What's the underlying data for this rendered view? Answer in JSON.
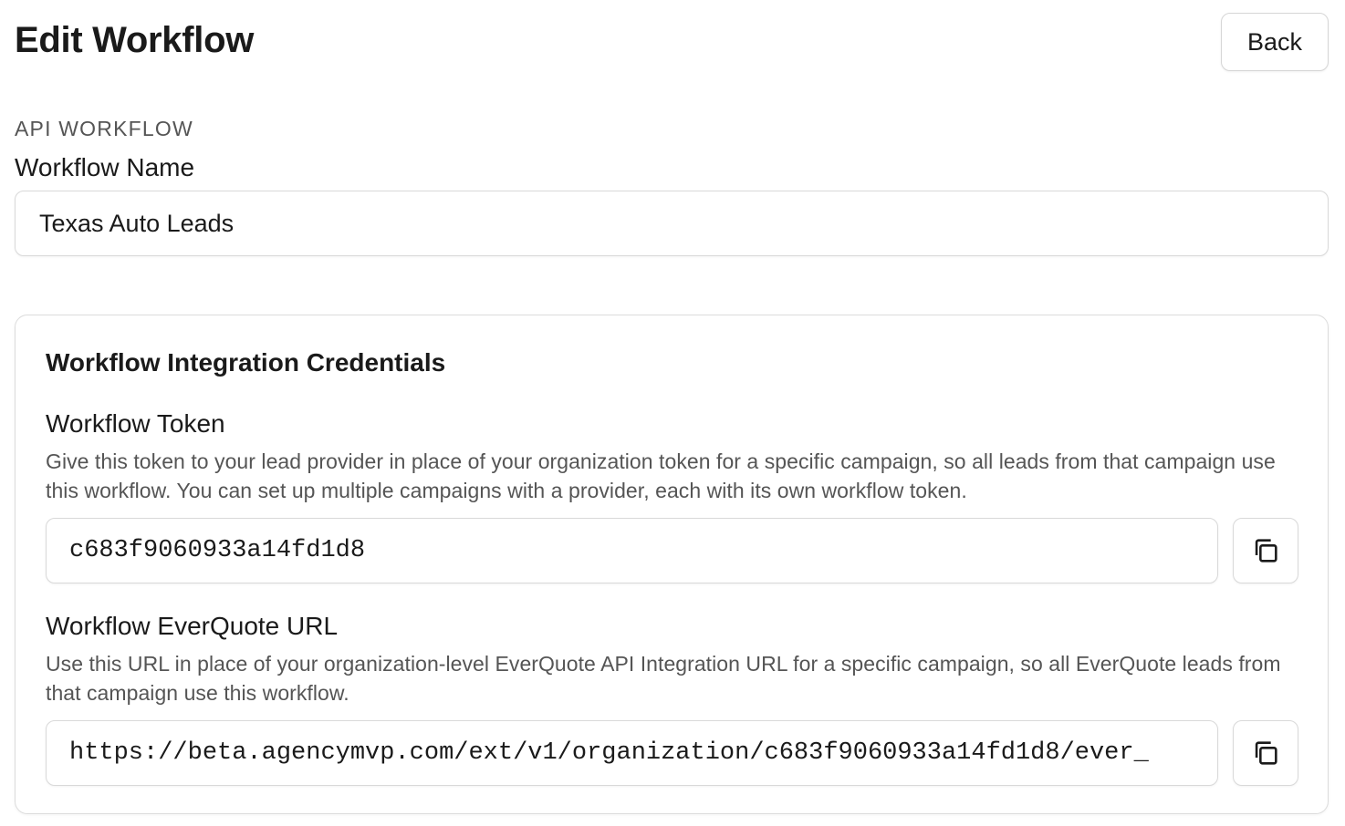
{
  "header": {
    "title": "Edit Workflow",
    "back_label": "Back"
  },
  "form": {
    "section_kicker": "API WORKFLOW",
    "name_label": "Workflow Name",
    "name_value": "Texas Auto Leads"
  },
  "credentials": {
    "title": "Workflow Integration Credentials",
    "token": {
      "label": "Workflow Token",
      "help": "Give this token to your lead provider in place of your organization token for a specific campaign, so all leads from that campaign use this workflow. You can set up multiple campaigns with a provider, each with its own workflow token.",
      "value": "c683f9060933a14fd1d8",
      "copy_icon": "copy-icon"
    },
    "everquote": {
      "label": "Workflow EverQuote URL",
      "help": "Use this URL in place of your organization-level EverQuote API Integration URL for a specific campaign, so all EverQuote leads from that campaign use this workflow.",
      "value": "https://beta.agencymvp.com/ext/v1/organization/c683f9060933a14fd1d8/ever_",
      "copy_icon": "copy-icon"
    }
  }
}
